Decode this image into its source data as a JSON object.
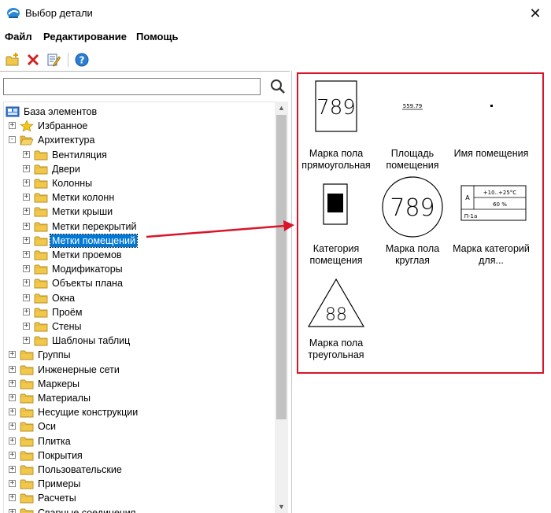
{
  "window": {
    "title": "Выбор детали",
    "close_glyph": "✕"
  },
  "menu": [
    "Файл",
    "Редактирование",
    "Помощь"
  ],
  "toolbar": [
    "add-folder-icon",
    "delete-icon",
    "edit-icon",
    "help-icon"
  ],
  "search": {
    "value": "",
    "icon": "search-icon"
  },
  "tree": {
    "root": "База элементов",
    "favorites": "Избранное",
    "architecture": "Архитектура",
    "architecture_children": [
      "Вентиляция",
      "Двери",
      "Колонны",
      "Метки колонн",
      "Метки крыши",
      "Метки перекрытий",
      "Метки помещений",
      "Метки проемов",
      "Модификаторы",
      "Объекты плана",
      "Окна",
      "Проём",
      "Стены",
      "Шаблоны таблиц"
    ],
    "selected": "Метки помещений",
    "top_level": [
      "Группы",
      "Инженерные сети",
      "Маркеры",
      "Материалы",
      "Несущие конструкции",
      "Оси",
      "Плитка",
      "Покрытия",
      "Пользовательские",
      "Примеры",
      "Расчеты",
      "Сварные соединения"
    ]
  },
  "items": [
    {
      "caption": "Марка пола прямоугольная",
      "number": "789"
    },
    {
      "caption": "Площадь помещения",
      "area": "559.79"
    },
    {
      "caption": "Имя помещения"
    },
    {
      "caption": "Категория помещения"
    },
    {
      "caption": "Марка пола круглая",
      "number": "789"
    },
    {
      "caption": "Марка категорий для...",
      "cell_a": "А",
      "cell_temp": "+10..+25°C",
      "cell_pct": "60 %",
      "cell_bottom": "П-1а"
    },
    {
      "caption": "Марка пола треугольная",
      "number": "88"
    }
  ],
  "colors": {
    "highlight": "#d9152a",
    "selection": "#0078d7",
    "folder": "#f2c84b"
  }
}
